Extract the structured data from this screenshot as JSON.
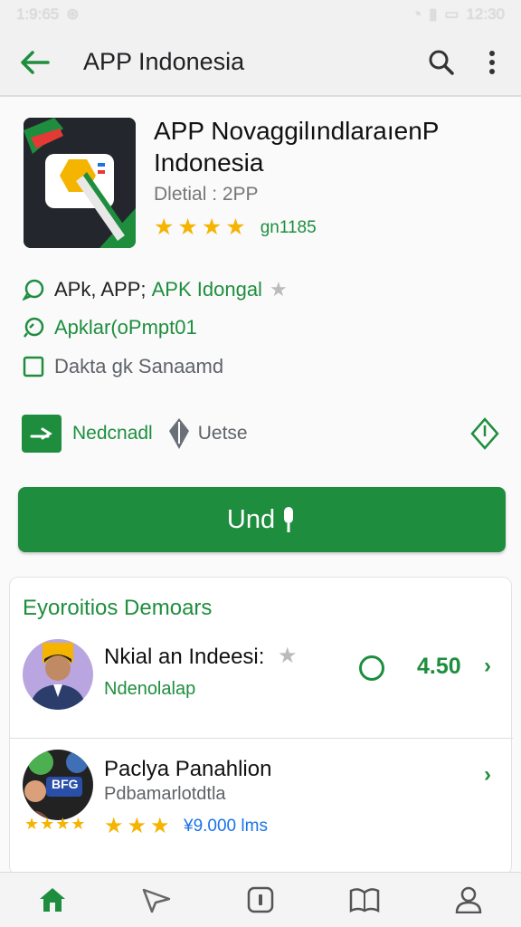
{
  "status_bar": {
    "time_left": "1:9:65",
    "time_right": "12:30"
  },
  "appbar": {
    "title": "APP Indonesia"
  },
  "app": {
    "title": "APP Novaggilındlaraıen​P Indonesia",
    "subtitle": "Dletial : 2PP",
    "rating_count": "​gn1185",
    "stars": 4
  },
  "features": [
    {
      "label_a": "APk, APP;",
      "label_b": "APK Idongal"
    },
    {
      "label": "Apklar(oPmpt01"
    },
    {
      "label": "Dakta gk Sanaamd"
    }
  ],
  "actions": {
    "primary_label": "Nedcnadl",
    "secondary_label": "Uetse"
  },
  "install_button": {
    "label": "Und"
  },
  "card": {
    "title": "Eyoroitios Demoars",
    "rows": [
      {
        "title": "Nkial an Indeesi:",
        "subtitle": "Ndenolalap",
        "number": "4.50"
      },
      {
        "title": "Paclya Panahlion",
        "subtitle": "Pdbamarlotdtla",
        "downloads": "¥9.000 lms",
        "badge": "BFG"
      }
    ]
  },
  "colors": {
    "accent": "#1e8e3e",
    "star": "#f4b400"
  }
}
